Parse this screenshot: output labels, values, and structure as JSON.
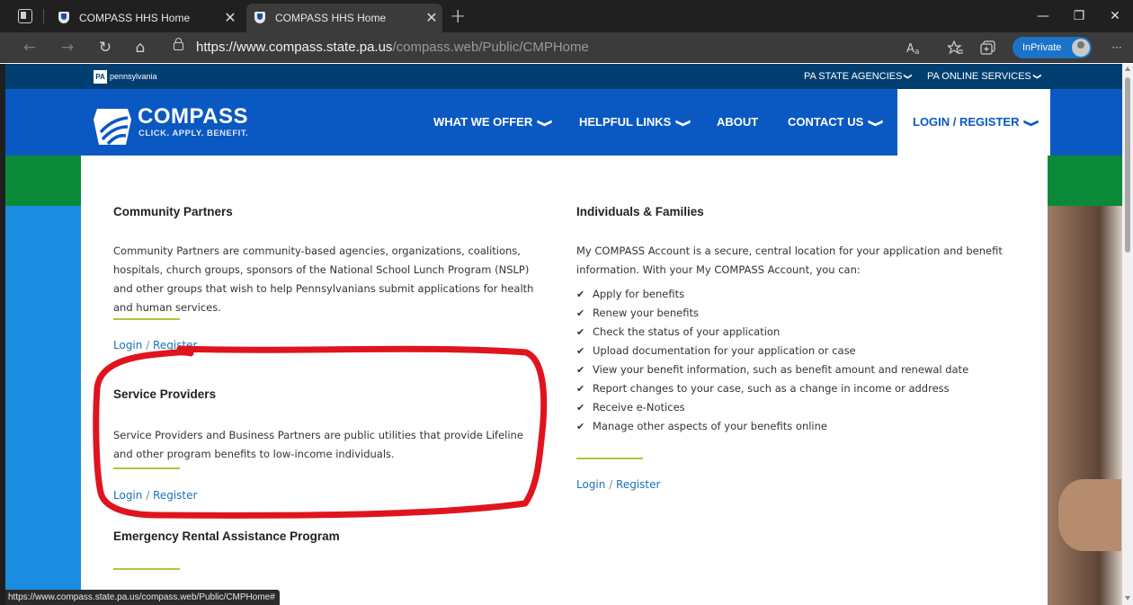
{
  "browser": {
    "tabs": [
      {
        "title": "COMPASS HHS Home",
        "active": false
      },
      {
        "title": "COMPASS HHS Home",
        "active": true
      }
    ],
    "close_glyph": "✕",
    "new_tab_glyph": "+",
    "window": {
      "minimize": "—",
      "restore": "❐",
      "close": "✕"
    },
    "nav": {
      "back": "←",
      "forward": "→",
      "refresh": "↻",
      "home": "⌂"
    },
    "address": {
      "host": "https://www.compass.state.pa.us",
      "path": "/compass.web/Public/CMPHome"
    },
    "toolbar_icons": [
      "read-aloud-icon",
      "favorites-icon",
      "collections-icon",
      "more-icon"
    ],
    "inprivate_label": "InPrivate",
    "more_glyph": "···",
    "status_url": "https://www.compass.state.pa.us/compass.web/Public/CMPHome#"
  },
  "site": {
    "state_bar": {
      "logo_mark": "PA",
      "logo_text": "pennsylvania",
      "links": [
        "PA STATE AGENCIES",
        "PA ONLINE SERVICES"
      ],
      "chevron": "❯"
    },
    "brand": {
      "name": "COMPASS",
      "tagline": "CLICK. APPLY. BENEFIT."
    },
    "menu": [
      {
        "label": "WHAT WE OFFER",
        "has_dropdown": true
      },
      {
        "label": "HELPFUL LINKS",
        "has_dropdown": true
      },
      {
        "label": "ABOUT",
        "has_dropdown": false
      },
      {
        "label": "CONTACT US",
        "has_dropdown": true
      },
      {
        "label": "LOGIN / REGISTER",
        "has_dropdown": true
      }
    ],
    "menu_chevron": "❯",
    "colors": {
      "state_bar": "#003f70",
      "header": "#0a58c2",
      "green": "#0a8a38",
      "rule": "#a6c93a",
      "link": "#1a73b8",
      "annotation": "#e0141e"
    }
  },
  "dropdown": {
    "left": [
      {
        "title": "Community Partners",
        "text": "Community Partners are community-based agencies, organizations, coalitions, hospitals, church groups, sponsors of the National School Lunch Program (NSLP) and other groups that wish to help Pennsylvanians submit applications for health and human services.",
        "login": "Login",
        "sep": " / ",
        "register": "Register"
      },
      {
        "title": "Service Providers",
        "text": "Service Providers and Business Partners are public utilities that provide Lifeline and other program benefits to low-income individuals.",
        "login": "Login",
        "sep": " / ",
        "register": "Register"
      },
      {
        "title": "Emergency Rental Assistance Program"
      }
    ],
    "right": {
      "title": "Individuals & Families",
      "intro": "My COMPASS Account is a secure, central location for your application and benefit information. With your My COMPASS Account, you can:",
      "check_glyph": "✔",
      "items": [
        "Apply for benefits",
        "Renew your benefits",
        "Check the status of your application",
        "Upload documentation for your application or case",
        "View your benefit information, such as benefit amount and renewal date",
        "Report changes to your case, such as a change in income or address",
        "Receive e-Notices",
        "Manage other aspects of your benefits online"
      ],
      "login": "Login",
      "sep": " / ",
      "register": "Register"
    }
  }
}
